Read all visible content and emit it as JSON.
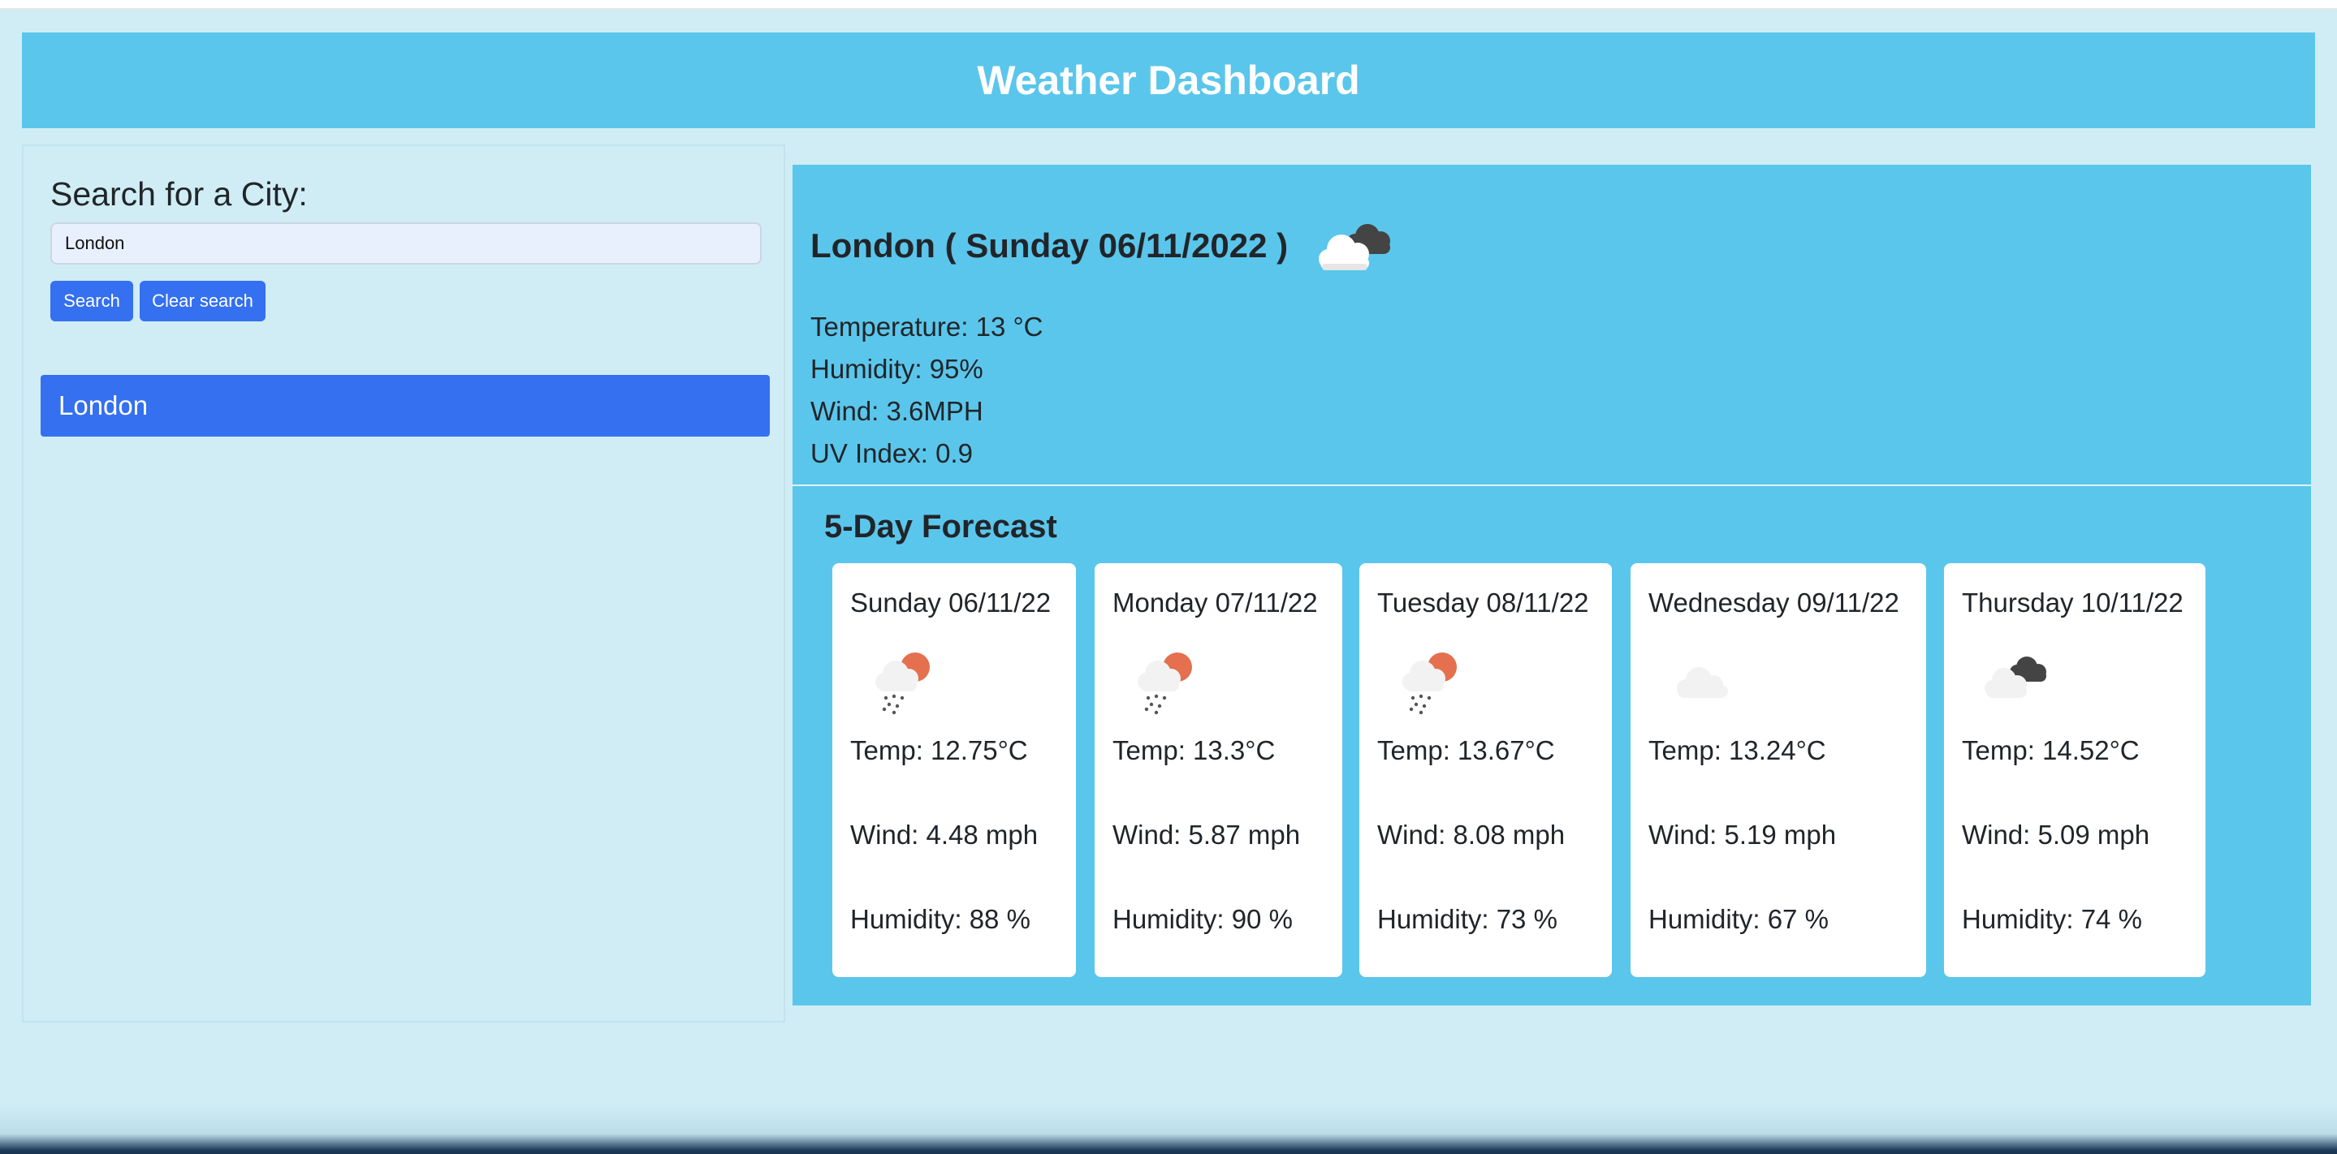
{
  "header": {
    "title": "Weather Dashboard"
  },
  "sidebar": {
    "search_title": "Search for a City:",
    "search_value": "London",
    "search_button": "Search",
    "clear_button": "Clear search",
    "history": [
      "London"
    ]
  },
  "today": {
    "title": "London ( Sunday 06/11/2022 )",
    "icon": "broken-clouds-icon",
    "temperature": "Temperature: 13 °C",
    "humidity": "Humidity: 95%",
    "wind": "Wind: 3.6MPH",
    "uv": "UV Index: 0.9"
  },
  "forecast": {
    "title": "5-Day Forecast",
    "days": [
      {
        "date": "Sunday 06/11/22",
        "icon": "rain-sun-icon",
        "temp": "Temp: 12.75°C",
        "wind": "Wind: 4.48 mph",
        "humidity": "Humidity: 88 %"
      },
      {
        "date": "Monday 07/11/22",
        "icon": "rain-sun-icon",
        "temp": "Temp: 13.3°C",
        "wind": "Wind: 5.87 mph",
        "humidity": "Humidity: 90 %"
      },
      {
        "date": "Tuesday 08/11/22",
        "icon": "rain-sun-icon",
        "temp": "Temp: 13.67°C",
        "wind": "Wind: 8.08 mph",
        "humidity": "Humidity: 73 %"
      },
      {
        "date": "Wednesday 09/11/22",
        "icon": "cloud-icon",
        "temp": "Temp: 13.24°C",
        "wind": "Wind: 5.19 mph",
        "humidity": "Humidity: 67 %"
      },
      {
        "date": "Thursday 10/11/22",
        "icon": "broken-clouds-icon",
        "temp": "Temp: 14.52°C",
        "wind": "Wind: 5.09 mph",
        "humidity": "Humidity: 74 %"
      }
    ]
  },
  "colors": {
    "accent": "#3470f0",
    "panel": "#5bc6eb",
    "background": "#d0edf6",
    "sun": "#e4704f",
    "dark_cloud": "#444444"
  }
}
